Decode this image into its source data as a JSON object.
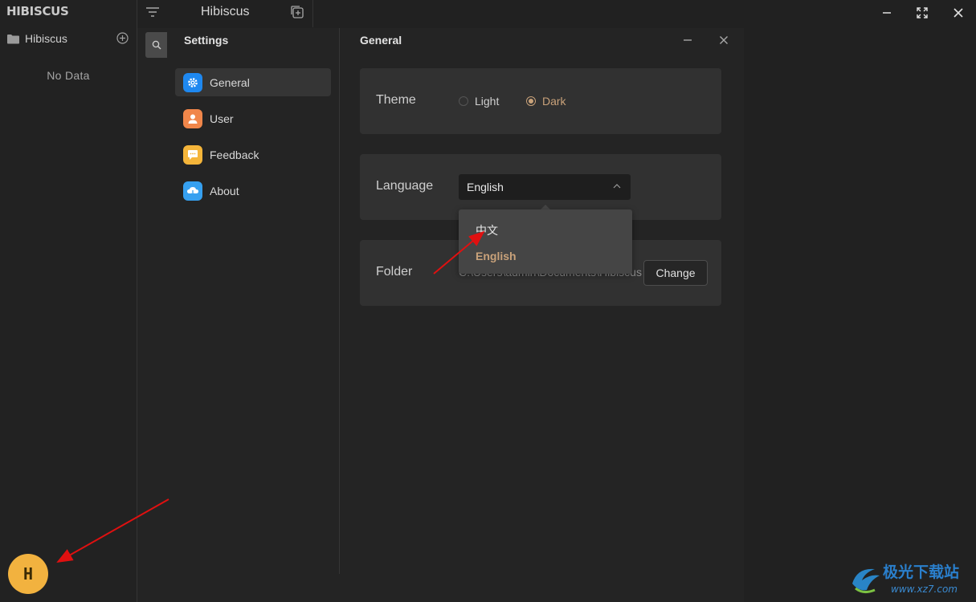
{
  "sidebar": {
    "logo": "HIBISCUS",
    "folder_name": "Hibiscus",
    "empty_text": "No Data",
    "avatar_letter": "H",
    "avatar_color": "#f2b23f"
  },
  "notes_header": {
    "title": "Hibiscus"
  },
  "settings": {
    "title": "Settings",
    "nav": [
      {
        "label": "General",
        "icon": "gear-icon",
        "color": "#1e88f0"
      },
      {
        "label": "User",
        "icon": "user-icon",
        "color": "#f0864a"
      },
      {
        "label": "Feedback",
        "icon": "chat-icon",
        "color": "#f5b53a"
      },
      {
        "label": "About",
        "icon": "cloud-icon",
        "color": "#36a0f0"
      }
    ],
    "active_section": "General"
  },
  "general": {
    "title": "General",
    "theme": {
      "label": "Theme",
      "options": [
        "Light",
        "Dark"
      ],
      "selected": "Dark"
    },
    "language": {
      "label": "Language",
      "value": "English",
      "options": [
        "中文",
        "English"
      ],
      "selected": "English"
    },
    "folder": {
      "label": "Folder",
      "path": "C:\\Users\\admin\\Documents\\Hibiscus",
      "button_label": "Change"
    }
  },
  "colors": {
    "accent": "#c9a27a",
    "background": "#212121",
    "card": "#313131"
  },
  "watermark": {
    "brand_text": "极光下载站",
    "url_text": "www.xz7.com"
  }
}
